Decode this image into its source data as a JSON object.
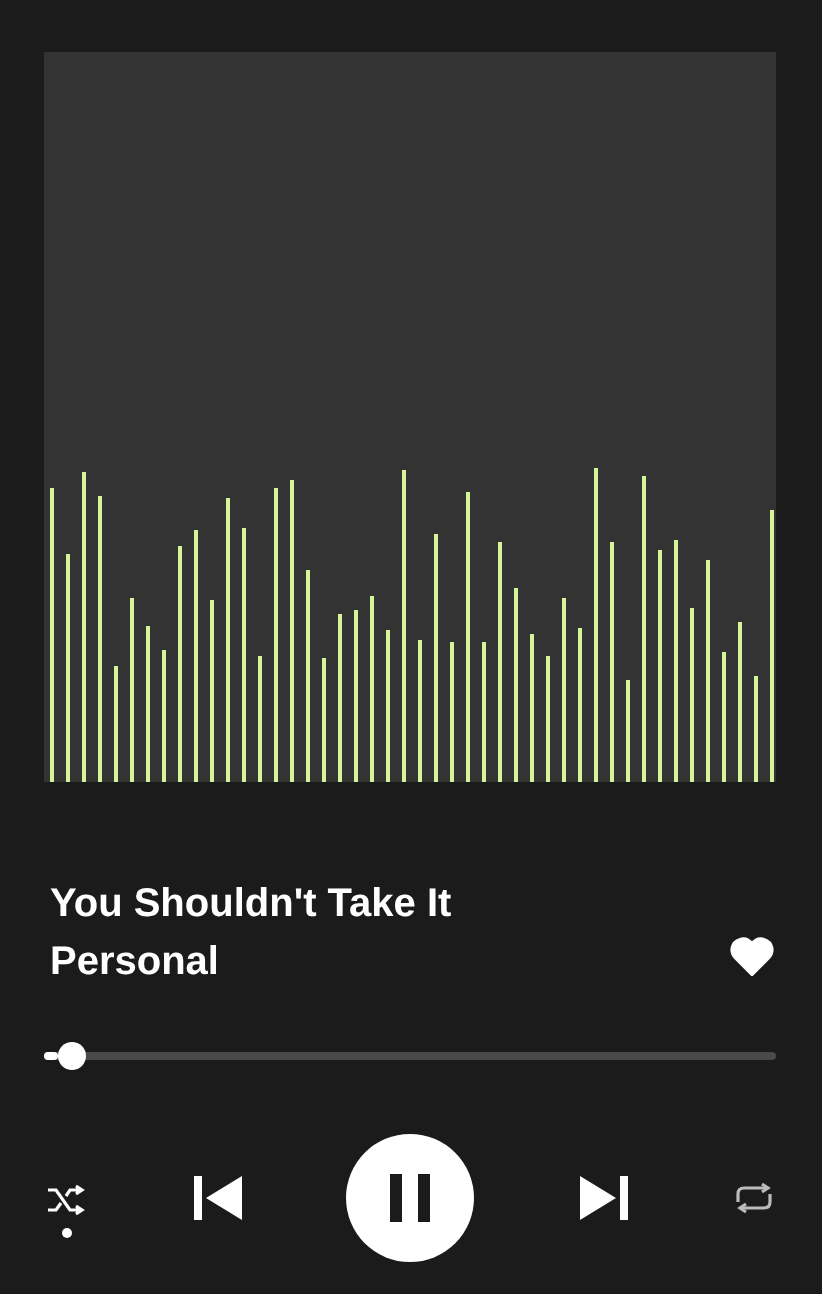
{
  "track": {
    "title": "You Shouldn't Take It Personal",
    "liked": true
  },
  "progress": {
    "level": 0.02
  },
  "controls": {
    "shuffle": true,
    "playing": true
  }
}
